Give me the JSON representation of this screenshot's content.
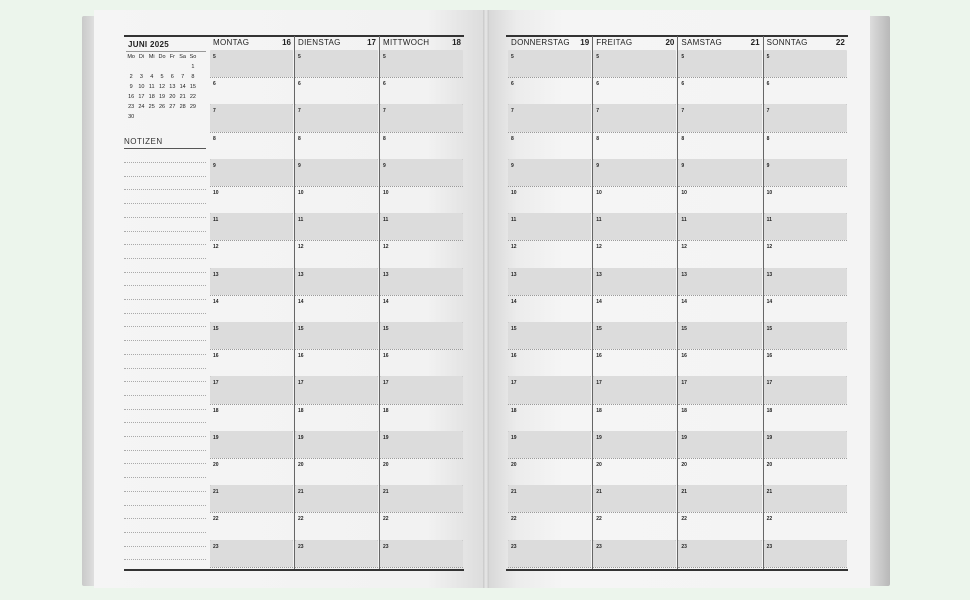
{
  "mini_calendar": {
    "title": "JUNI 2025",
    "weekdays": [
      "Mo",
      "Di",
      "Mi",
      "Do",
      "Fr",
      "Sa",
      "So"
    ],
    "weeks": [
      [
        "",
        "",
        "",
        "",
        "",
        "",
        "1"
      ],
      [
        "2",
        "3",
        "4",
        "5",
        "6",
        "7",
        "8"
      ],
      [
        "9",
        "10",
        "11",
        "12",
        "13",
        "14",
        "15"
      ],
      [
        "16",
        "17",
        "18",
        "19",
        "20",
        "21",
        "22"
      ],
      [
        "23",
        "24",
        "25",
        "26",
        "27",
        "28",
        "29"
      ],
      [
        "30",
        "",
        "",
        "",
        "",
        "",
        ""
      ]
    ]
  },
  "notes": {
    "label": "NOTIZEN"
  },
  "left_days": [
    {
      "name": "MONTAG",
      "date": "16"
    },
    {
      "name": "DIENSTAG",
      "date": "17"
    },
    {
      "name": "MITTWOCH",
      "date": "18"
    }
  ],
  "right_days": [
    {
      "name": "DONNERSTAG",
      "date": "19"
    },
    {
      "name": "FREITAG",
      "date": "20"
    },
    {
      "name": "SAMSTAG",
      "date": "21"
    },
    {
      "name": "SONNTAG",
      "date": "22"
    }
  ],
  "hours": [
    "5",
    "6",
    "7",
    "8",
    "9",
    "10",
    "11",
    "12",
    "13",
    "14",
    "15",
    "16",
    "17",
    "18",
    "19",
    "20",
    "21",
    "22",
    "23"
  ]
}
